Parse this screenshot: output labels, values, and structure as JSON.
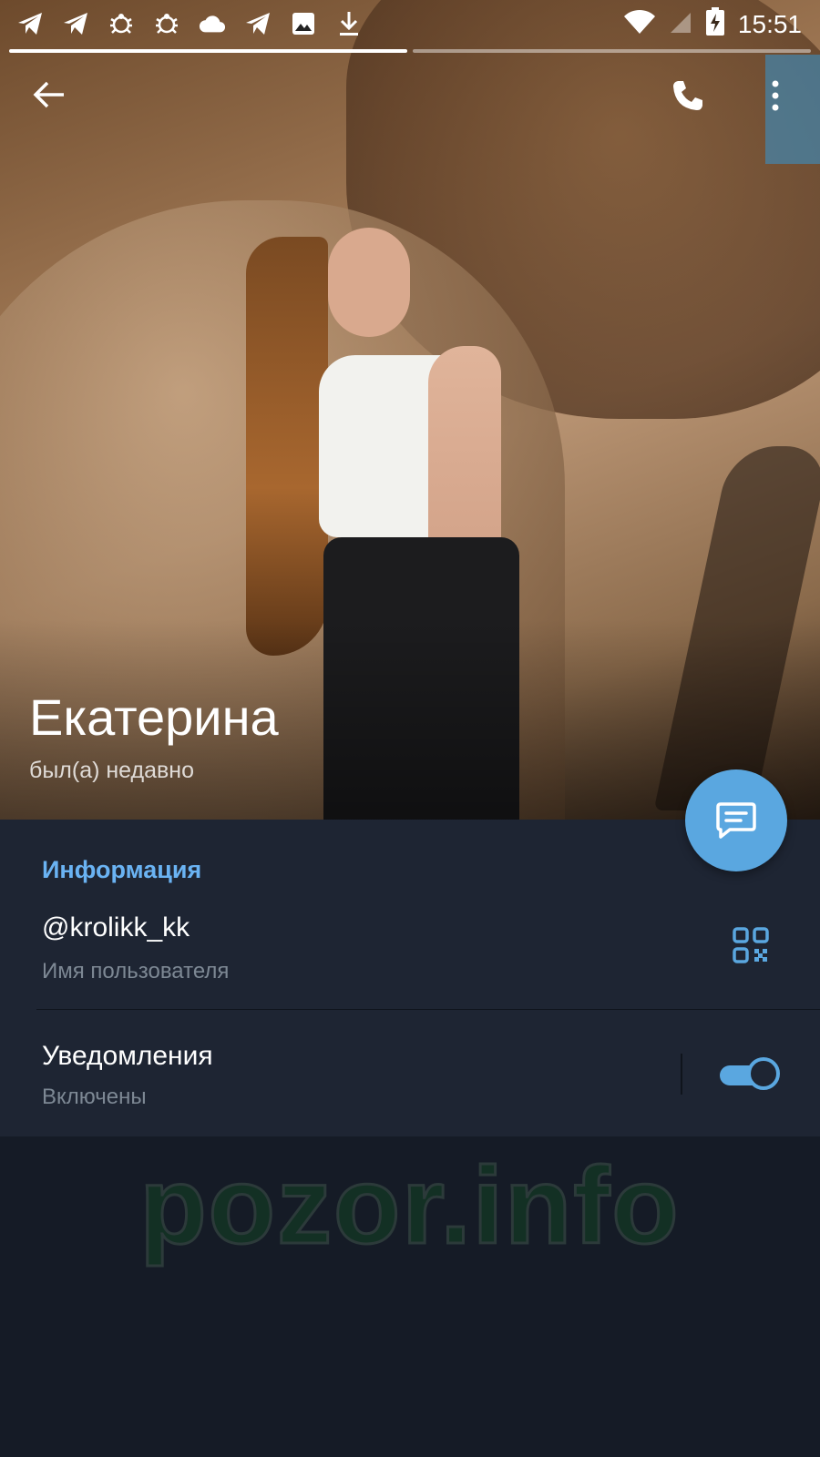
{
  "status_bar": {
    "time": "15:51",
    "notification_icons": [
      "telegram-icon",
      "telegram-icon",
      "bug-icon",
      "bug-icon",
      "cloud-icon",
      "telegram-icon",
      "image-icon",
      "download-icon"
    ],
    "system_icons": [
      "wifi-icon",
      "signal-icon",
      "battery-charging-icon"
    ]
  },
  "story_progress": {
    "segments": 2,
    "active": 0
  },
  "profile": {
    "name": "Екатерина",
    "status": "был(а) недавно"
  },
  "info": {
    "section_title": "Информация",
    "username": "@krolikk_kk",
    "username_label": "Имя пользователя",
    "notifications_title": "Уведомления",
    "notifications_status": "Включены",
    "notifications_enabled": true
  },
  "watermark": "pozor.info",
  "colors": {
    "accent": "#5aa7e0",
    "section_title": "#6ab3f3",
    "panel_bg": "#1e2533",
    "page_bg": "#151b26"
  }
}
